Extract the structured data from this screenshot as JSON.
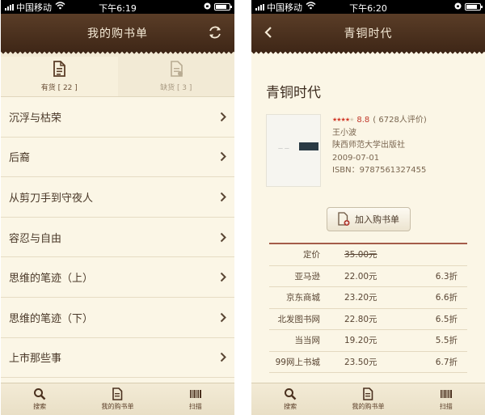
{
  "left": {
    "status": {
      "carrier": "中国移动",
      "time": "下午6:19"
    },
    "nav": {
      "title": "我的购书单"
    },
    "tabs": [
      {
        "label": "有货 [ 22 ]"
      },
      {
        "label": "缺货 [ 3 ]"
      }
    ],
    "books": [
      "沉浮与枯荣",
      "后裔",
      "从剪刀手到守夜人",
      "容忍与自由",
      "思维的笔迹（上）",
      "思维的笔迹（下）",
      "上市那些事"
    ],
    "tabbar": [
      {
        "label": "搜索",
        "icon": "search-icon"
      },
      {
        "label": "我的购书单",
        "icon": "document-icon"
      },
      {
        "label": "扫描",
        "icon": "barcode-icon"
      }
    ]
  },
  "right": {
    "status": {
      "carrier": "中国移动",
      "time": "下午6:20"
    },
    "nav": {
      "title": "青铜时代"
    },
    "book": {
      "title": "青铜时代",
      "rating_stars": 4,
      "score": "8.8",
      "reviews": "( 6728人评价)",
      "author": "王小波",
      "publisher": "陕西师范大学出版社",
      "date": "2009-07-01",
      "isbn": "ISBN：9787561327455"
    },
    "add_button": "加入购书单",
    "list_price": {
      "label": "定价",
      "value": "35.00元"
    },
    "prices": [
      {
        "store": "亚马逊",
        "price": "22.00元",
        "discount": "6.3折"
      },
      {
        "store": "京东商城",
        "price": "23.20元",
        "discount": "6.6折"
      },
      {
        "store": "北发图书网",
        "price": "22.80元",
        "discount": "6.5折"
      },
      {
        "store": "当当网",
        "price": "19.20元",
        "discount": "5.5折"
      },
      {
        "store": "99网上书城",
        "price": "23.50元",
        "discount": "6.7折"
      }
    ],
    "tabbar": [
      {
        "label": "搜索",
        "icon": "search-icon"
      },
      {
        "label": "我的购书单",
        "icon": "document-icon"
      },
      {
        "label": "扫描",
        "icon": "barcode-icon"
      }
    ]
  },
  "colors": {
    "navbar": "#4a301e",
    "background": "#fbf6e6",
    "accent_red": "#c0392b"
  }
}
